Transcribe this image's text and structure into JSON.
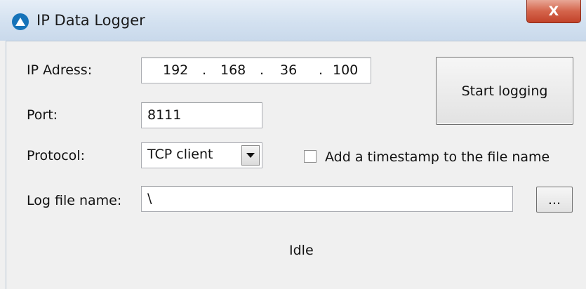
{
  "window": {
    "title": "IP Data Logger",
    "close_glyph": "X"
  },
  "form": {
    "ip_label": "IP Adress:",
    "ip_octets": [
      "192",
      "168",
      "36",
      "100"
    ],
    "ip_separator": ".",
    "port_label": "Port:",
    "port_value": "8111",
    "protocol_label": "Protocol:",
    "protocol_value": "TCP client",
    "timestamp_label": "Add a timestamp to the file name",
    "timestamp_checked": false,
    "logfile_label": "Log file name:",
    "logfile_value": "\\"
  },
  "buttons": {
    "start_label": "Start logging",
    "browse_label": "..."
  },
  "status": {
    "text": "Idle"
  },
  "icons": {
    "app": "app-logo-icon",
    "close": "close-icon",
    "dropdown": "chevron-down-icon"
  }
}
